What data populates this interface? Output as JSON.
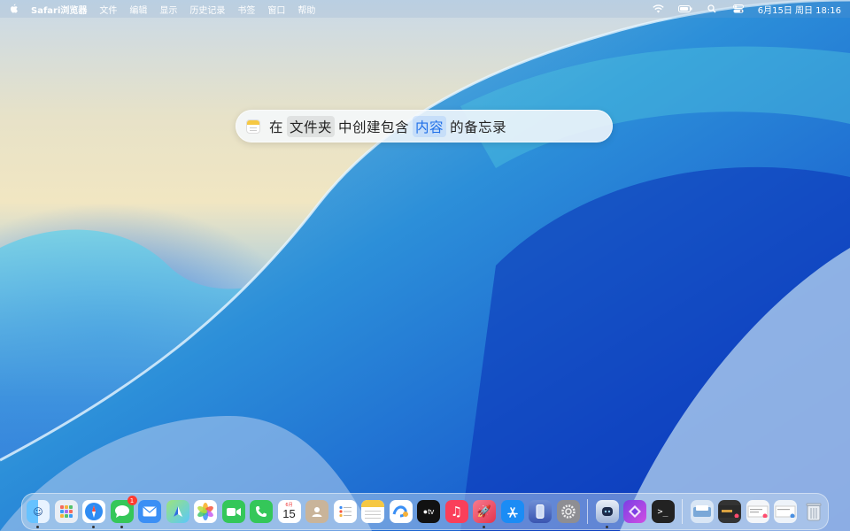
{
  "menubar": {
    "app_name": "Safari浏览器",
    "menus": [
      "文件",
      "编辑",
      "显示",
      "历史记录",
      "书签",
      "窗口",
      "帮助"
    ],
    "datetime": "6月15日 周日  18:16"
  },
  "spotlight": {
    "icon": "notes-icon",
    "text_1": "在",
    "chip_1": "文件夹",
    "text_2": "中创建包含",
    "chip_2": "内容",
    "text_3": "的备忘录"
  },
  "dock": {
    "messages_badge": "1",
    "calendar_month": "6月",
    "calendar_day": "15",
    "colors": {
      "finder": "#3aa2f5",
      "safari": "#2f8cf3",
      "messages": "#35c759",
      "mail": "#3a8ff5",
      "facetime": "#34c759",
      "phone": "#34c759",
      "music": "#fa3f5a",
      "appstore": "#1b8cf5",
      "shortcuts": "#7b3fe4",
      "terminal": "#222222"
    }
  }
}
